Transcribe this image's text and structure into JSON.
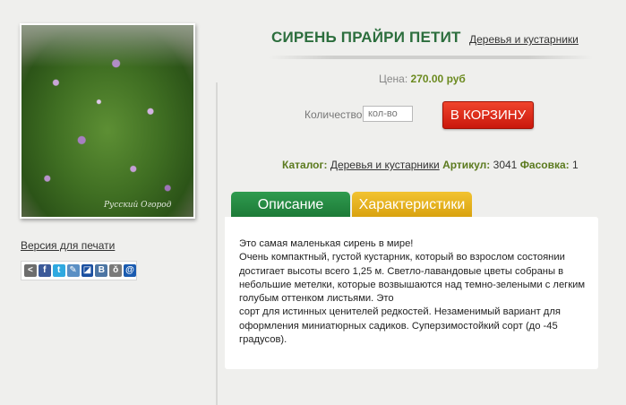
{
  "product": {
    "title": "СИРЕНЬ ПРАЙРИ ПЕТИТ",
    "category_link": "Деревья и кустарники",
    "photo_watermark": "Русский Огород"
  },
  "left": {
    "print_link": "Версия для печати",
    "share_icons": [
      {
        "name": "share-icon",
        "glyph": "<",
        "color": "#6d6d6d"
      },
      {
        "name": "facebook-icon",
        "glyph": "f",
        "color": "#3b5998"
      },
      {
        "name": "twitter-icon",
        "glyph": "t",
        "color": "#2fa9e0"
      },
      {
        "name": "livejournal-icon",
        "glyph": "✎",
        "color": "#5a8fc4"
      },
      {
        "name": "delicious-icon",
        "glyph": "◪",
        "color": "#1a4fa0"
      },
      {
        "name": "vkontakte-icon",
        "glyph": "B",
        "color": "#4c75a3"
      },
      {
        "name": "odnoklassniki-icon",
        "glyph": "ǒ",
        "color": "#7a7a7a"
      },
      {
        "name": "mailru-icon",
        "glyph": "@",
        "color": "#1a5bb0"
      }
    ]
  },
  "price": {
    "label": "Цена:",
    "value": "270.00 руб"
  },
  "quantity": {
    "label": "Количество:",
    "placeholder": "кол-во"
  },
  "cart_button": "В КОРЗИНУ",
  "meta": {
    "catalog_label": "Каталог:",
    "catalog_value": "Деревья и кустарники",
    "sku_label": "Артикул:",
    "sku_value": "3041",
    "pack_label": "Фасовка:",
    "pack_value": "1"
  },
  "tabs": [
    {
      "label": "Описание"
    },
    {
      "label": "Характеристики"
    }
  ],
  "description": {
    "line1": "Это самая маленькая сирень в мире!",
    "line2": "Очень компактный, густой кустарник, который во взрослом состоянии достигает высоты всего 1,25 м. Светло-лавандовые цветы собраны в небольшие метелки, которые возвышаются над темно-зелеными с легким голубым оттенком листьями. Это",
    "line3": "сорт для истинных ценителей редкостей. Незаменимый вариант для оформления миниатюрных садиков. Суперзимостойкий сорт (до -45 градусов)."
  },
  "colors": {
    "title_green": "#2c6e3d",
    "tab_active": "#2f9b4f",
    "tab_inactive": "#f2c332",
    "cart_red": "#e3301e"
  }
}
